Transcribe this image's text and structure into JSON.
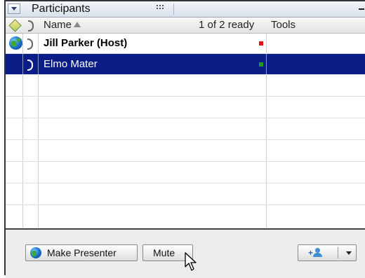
{
  "panel": {
    "title": "Participants"
  },
  "grid": {
    "columns": {
      "name": "Name",
      "ready": "1 of 2 ready",
      "tools": "Tools"
    },
    "rows": [
      {
        "name": "Jill Parker (Host)",
        "bold": true,
        "presenter": true,
        "status_color": "#e81010",
        "selected": false
      },
      {
        "name": "Elmo Mater",
        "bold": false,
        "presenter": false,
        "status_color": "#1f9a1f",
        "selected": true
      }
    ]
  },
  "toolbar": {
    "make_presenter": "Make Presenter",
    "mute": "Mute"
  },
  "colors": {
    "selection": "#0b1d86",
    "not_ready": "#e81010",
    "ready": "#1f9a1f"
  },
  "icons": [
    "collapse-arrow-icon",
    "grip-icon",
    "minimize-icon",
    "presenter-diamond-icon",
    "phone-icon",
    "sort-ascending-icon",
    "globe-icon",
    "add-user-icon",
    "dropdown-arrow-icon",
    "mouse-cursor-icon"
  ]
}
